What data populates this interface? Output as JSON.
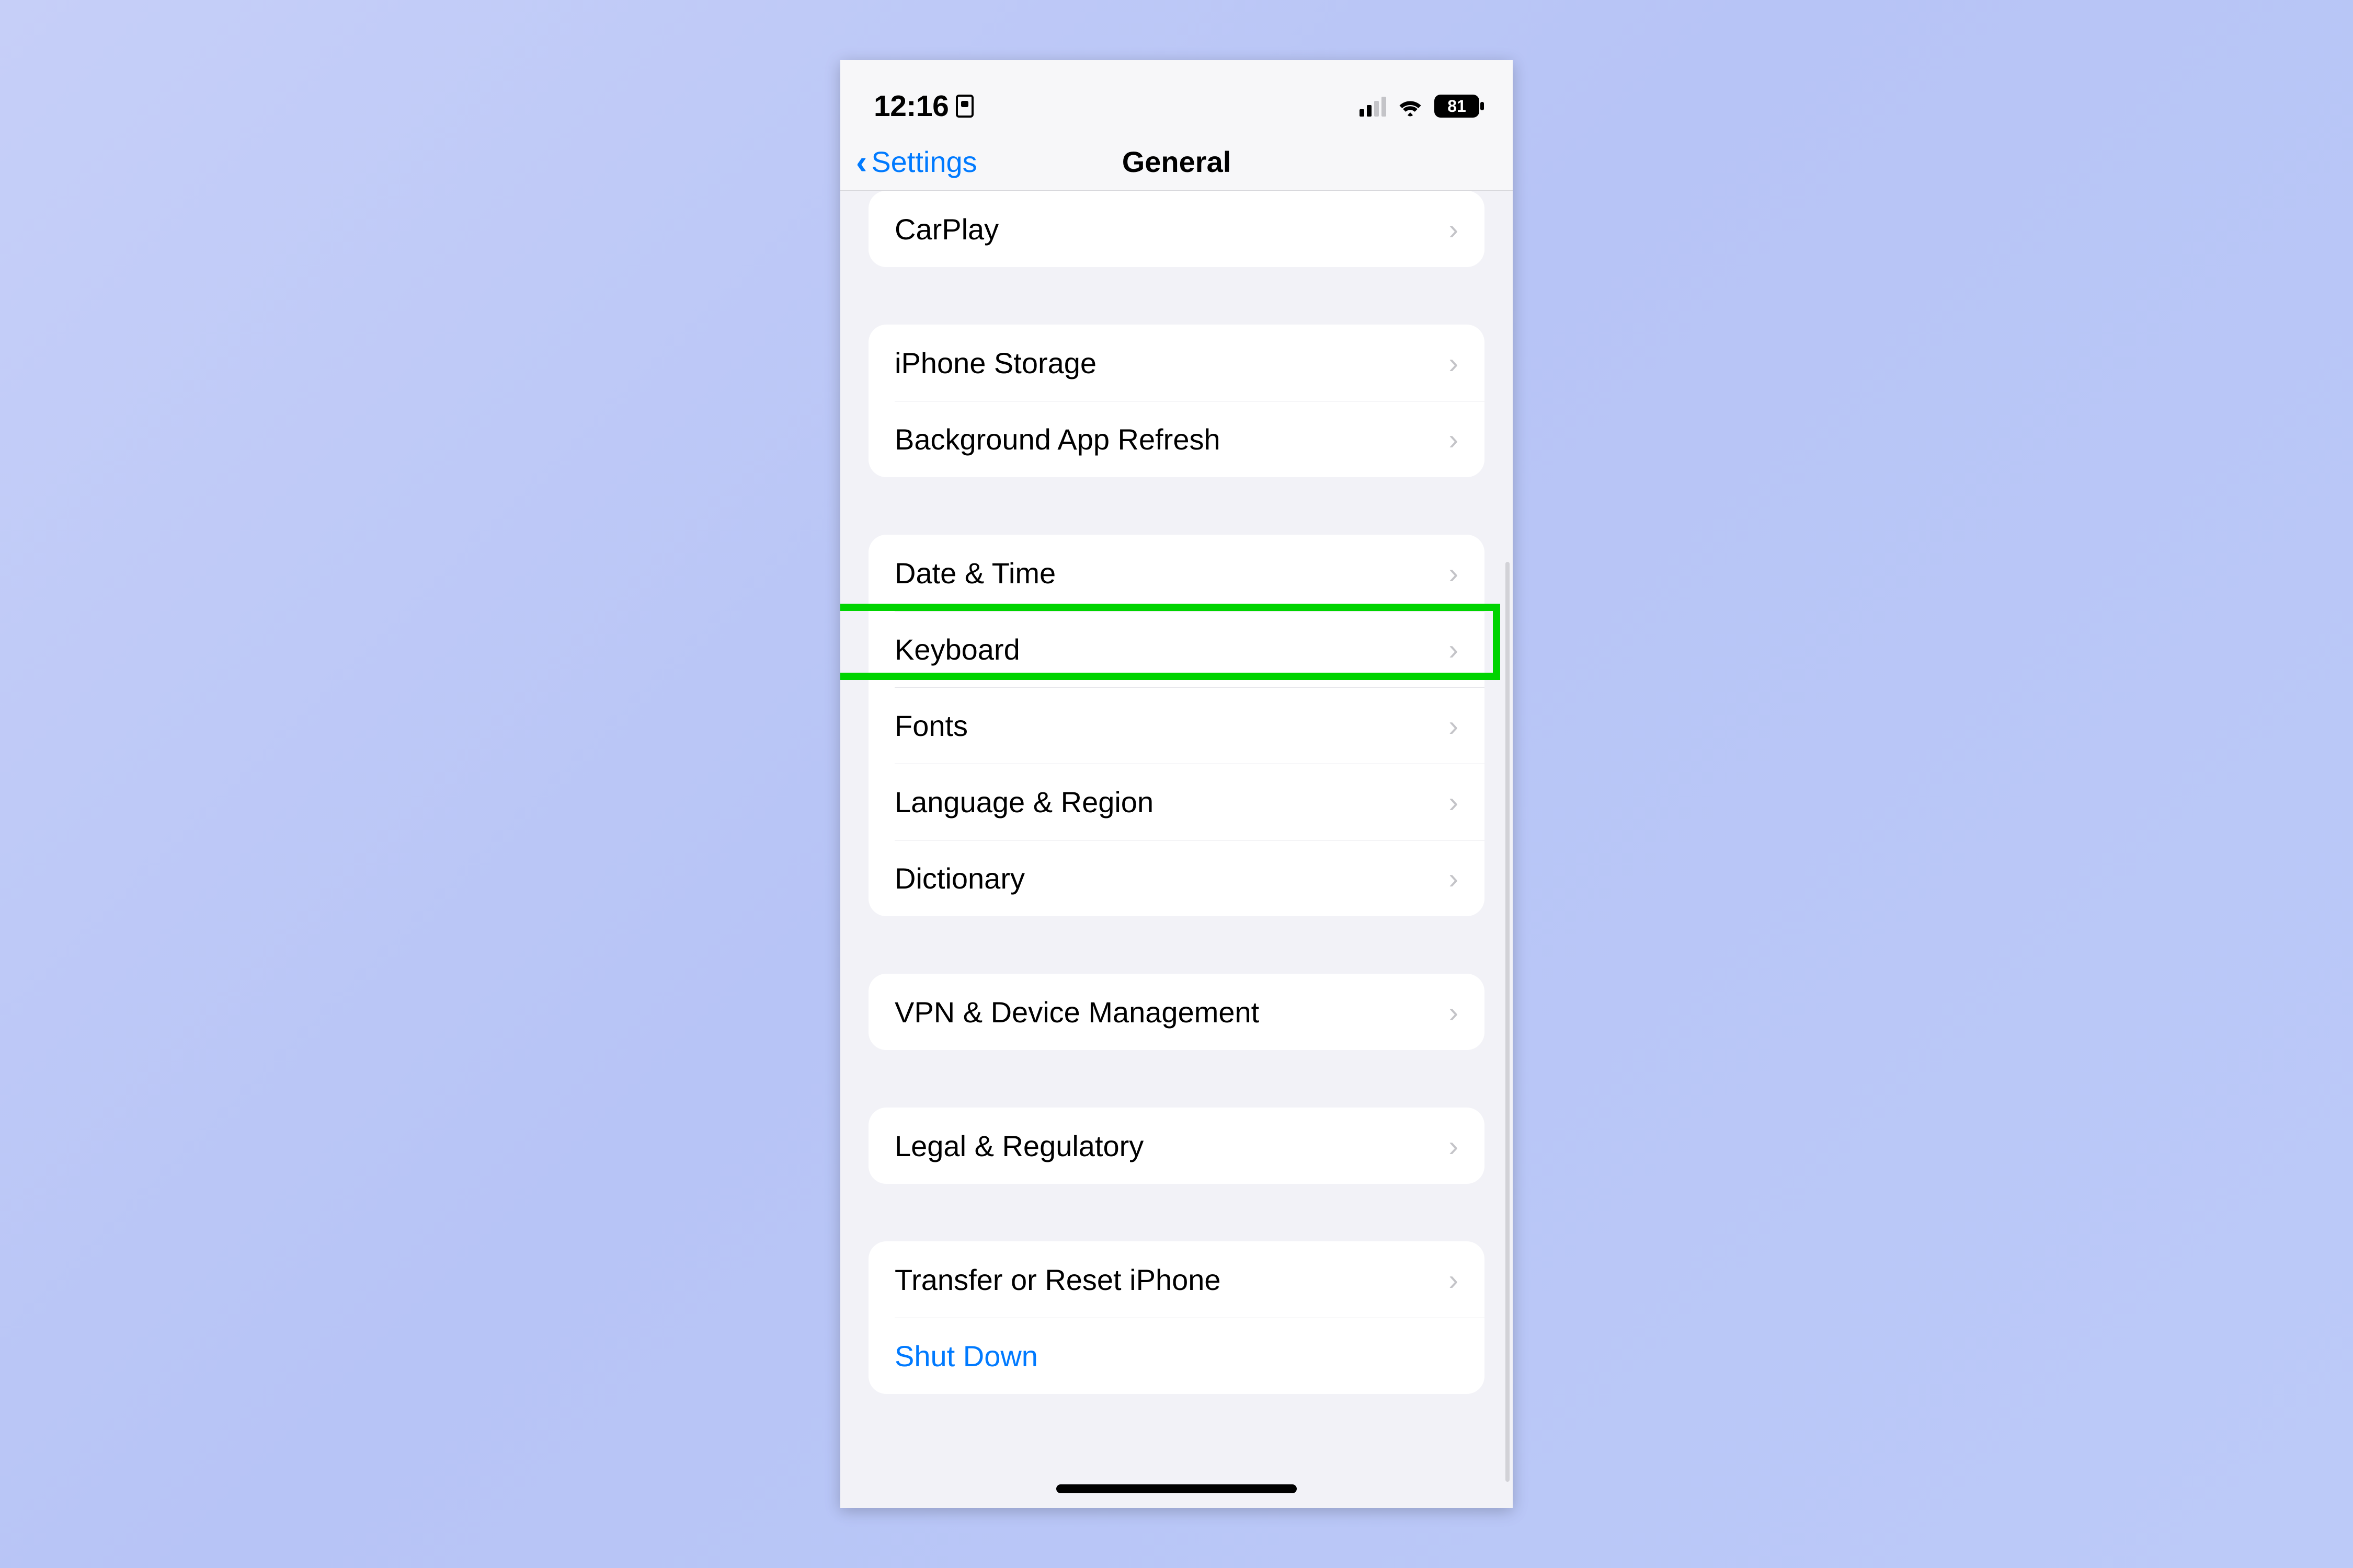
{
  "status": {
    "time": "12:16",
    "battery_percent": "81"
  },
  "nav": {
    "back_label": "Settings",
    "title": "General"
  },
  "groups": [
    {
      "rows": [
        {
          "label": "CarPlay",
          "chevron": true
        }
      ]
    },
    {
      "rows": [
        {
          "label": "iPhone Storage",
          "chevron": true
        },
        {
          "label": "Background App Refresh",
          "chevron": true
        }
      ]
    },
    {
      "rows": [
        {
          "label": "Date & Time",
          "chevron": true
        },
        {
          "label": "Keyboard",
          "chevron": true,
          "highlighted": true
        },
        {
          "label": "Fonts",
          "chevron": true
        },
        {
          "label": "Language & Region",
          "chevron": true
        },
        {
          "label": "Dictionary",
          "chevron": true
        }
      ]
    },
    {
      "rows": [
        {
          "label": "VPN & Device Management",
          "chevron": true
        }
      ]
    },
    {
      "rows": [
        {
          "label": "Legal & Regulatory",
          "chevron": true
        }
      ]
    },
    {
      "rows": [
        {
          "label": "Transfer or Reset iPhone",
          "chevron": true
        },
        {
          "label": "Shut Down",
          "chevron": false,
          "link": true
        }
      ]
    }
  ],
  "colors": {
    "tint": "#007aff",
    "highlight_border": "#00d400",
    "background": "#f2f2f7"
  }
}
